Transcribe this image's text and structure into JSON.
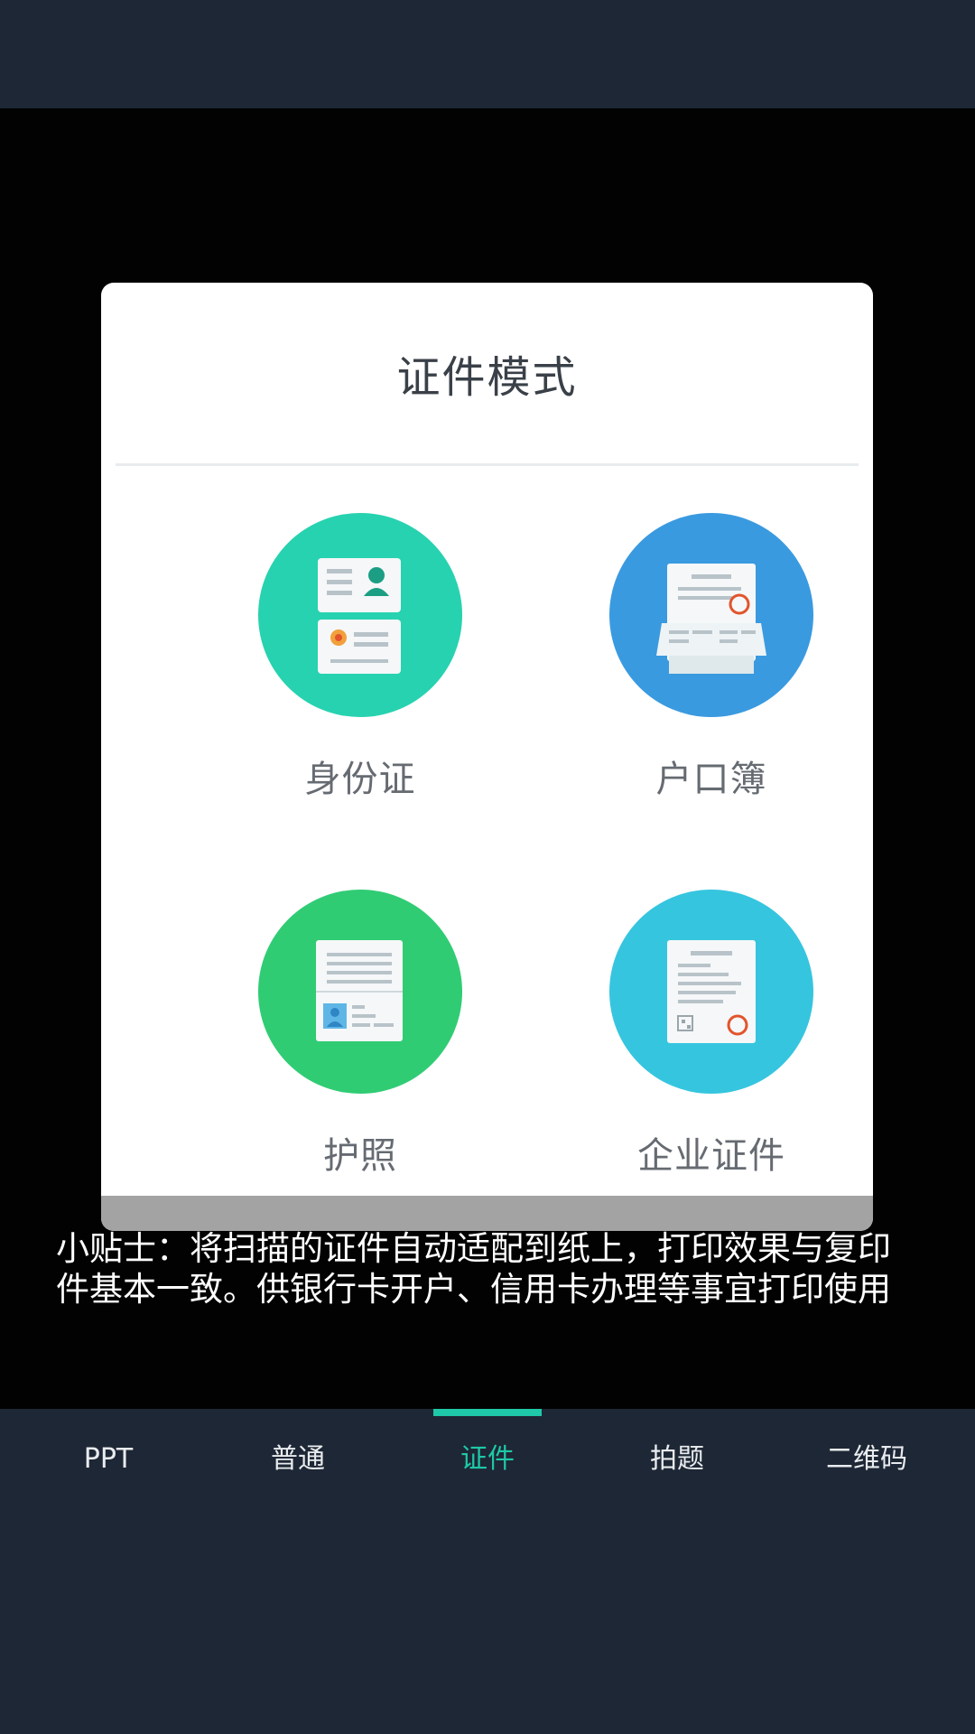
{
  "dialog": {
    "title": "证件模式",
    "modes": [
      {
        "label": "身份证",
        "icon": "id-card-icon",
        "color": "#27d2b0"
      },
      {
        "label": "户口簿",
        "icon": "household-register-icon",
        "color": "#3a9ae0"
      },
      {
        "label": "护照",
        "icon": "passport-icon",
        "color": "#30cc74"
      },
      {
        "label": "企业证件",
        "icon": "business-license-icon",
        "color": "#36c5df"
      }
    ]
  },
  "tip": "小贴士：将扫描的证件自动适配到纸上，打印效果与复印件基本一致。供银行卡开户、信用卡办理等事宜打印使用",
  "tabs": [
    {
      "label": "PPT",
      "active": false
    },
    {
      "label": "普通",
      "active": false
    },
    {
      "label": "证件",
      "active": true
    },
    {
      "label": "拍题",
      "active": false
    },
    {
      "label": "二维码",
      "active": false
    }
  ],
  "colors": {
    "accent": "#1ec8a8",
    "background": "#1e2735"
  }
}
